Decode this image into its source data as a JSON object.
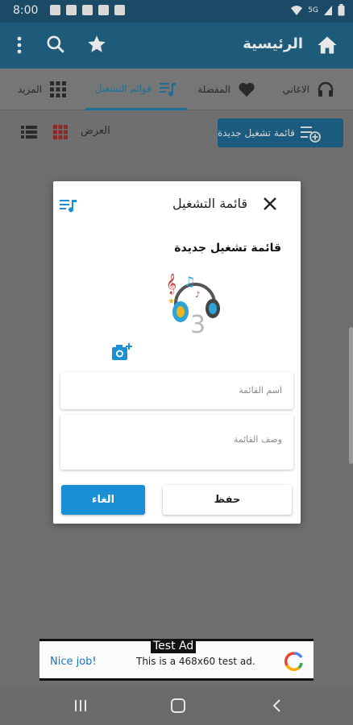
{
  "status_bar": {
    "time": "8:00",
    "net_label": "5G"
  },
  "app_bar": {
    "title": "الرئيسية"
  },
  "tabs": [
    {
      "label": "الاغاني",
      "icon": "headphones-icon"
    },
    {
      "label": "المفضلة",
      "icon": "heart-icon"
    },
    {
      "label": "قوائم التشغيل",
      "icon": "playlist-icon",
      "active": true
    },
    {
      "label": "المزيد",
      "icon": "grid-icon"
    }
  ],
  "toolbar": {
    "new_playlist_label": "قائمة تشغيل جديدة",
    "view_label": "العرض"
  },
  "dialog": {
    "title": "قائمة التشغيل",
    "subtitle": "قائمة تشغيل جديدة",
    "name_placeholder": "اسم القائمة",
    "description_placeholder": "وصف القائمة",
    "save_label": "حفظ",
    "cancel_label": "الغاء"
  },
  "ad": {
    "tag": "Test Ad",
    "left_text": "Nice job!",
    "body_text": "This is a 468x60 test ad."
  },
  "colors": {
    "accent": "#1a8fd6",
    "app_bar": "#1e5a7a"
  }
}
